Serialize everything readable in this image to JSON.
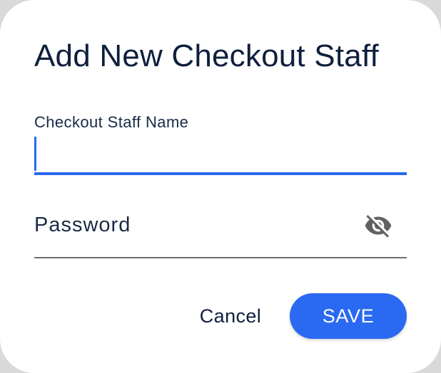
{
  "dialog": {
    "title": "Add New Checkout Staff",
    "name_field": {
      "label": "Checkout Staff Name",
      "value": ""
    },
    "password_field": {
      "placeholder": "Password",
      "value": "",
      "toggle_icon": "eye-off-icon"
    },
    "actions": {
      "cancel_label": "Cancel",
      "save_label": "SAVE"
    }
  },
  "colors": {
    "accent": "#2968f0",
    "text": "#0f1f3d",
    "icon": "#616161"
  }
}
